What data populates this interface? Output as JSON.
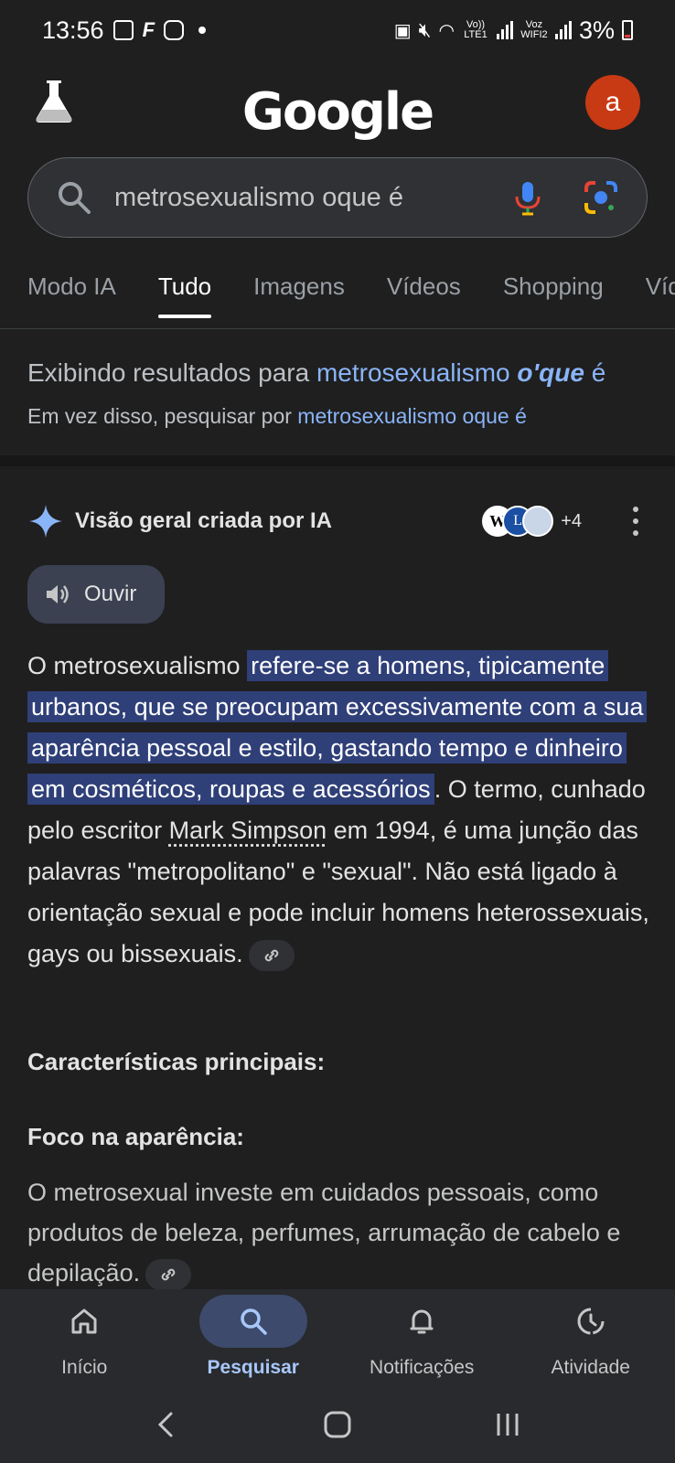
{
  "status_bar": {
    "time": "13:56",
    "lte_label": "Vo)) LTE1",
    "wifi_label": "Voz WIFI2",
    "battery": "3%"
  },
  "header": {
    "logo": "Google",
    "avatar_letter": "a"
  },
  "search": {
    "query": "metrosexualismo oque é"
  },
  "tabs": [
    "Modo IA",
    "Tudo",
    "Imagens",
    "Vídeos",
    "Shopping",
    "Víd"
  ],
  "active_tab": "Tudo",
  "correction": {
    "showing_prefix": "Exibindo resultados para ",
    "showing_term": "metrosexualismo ",
    "showing_corrected": "o'que",
    "showing_suffix": " é",
    "instead_prefix": "Em vez disso, pesquisar por ",
    "instead_term": "metrosexualismo oque é"
  },
  "ai_overview": {
    "title": "Visão geral criada por IA",
    "sources_count": "+4",
    "listen_label": "Ouvir",
    "answer_intro": "O metrosexualismo ",
    "answer_highlight": "refere-se a homens, tipicamente urbanos, que se preocupam excessivamente com a sua aparência pessoal e estilo, gastando tempo e dinheiro em cosméticos, roupas e acessórios",
    "answer_part2": ". O termo, cunhado pelo escritor ",
    "answer_link": "Mark Simpson",
    "answer_part3": " em 1994, é uma junção das palavras \"metropolitano\" e \"sexual\". Não está ligado à orientação sexual e pode incluir homens heterossexuais, gays ou bissexuais.",
    "subhead_features": "Características principais:",
    "subhead_focus": "Foco na aparência:",
    "focus_text": "O metrosexual investe em cuidados pessoais, como produtos de beleza, perfumes, arrumação de cabelo e depilação."
  },
  "bottom_nav": [
    {
      "label": "Início",
      "icon": "home-icon"
    },
    {
      "label": "Pesquisar",
      "icon": "search-icon"
    },
    {
      "label": "Notificações",
      "icon": "bell-icon"
    },
    {
      "label": "Atividade",
      "icon": "history-icon"
    }
  ],
  "colors": {
    "background": "#1f1f1f",
    "link": "#8ab4f8",
    "highlight": "#2f3f78",
    "avatar": "#c83a14",
    "active_nav": "#a8c7fa"
  }
}
